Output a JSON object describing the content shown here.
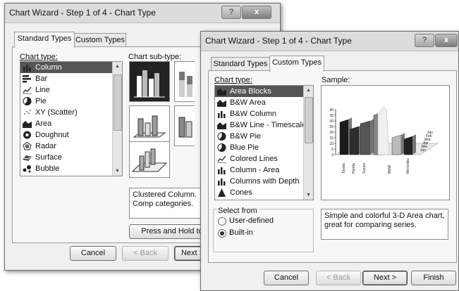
{
  "back_dialog": {
    "title": "Chart Wizard - Step 1 of 4 - Chart Type",
    "help_label": "?",
    "close_label": "x",
    "tabs": [
      {
        "label": "Standard Types",
        "active": true
      },
      {
        "label": "Custom Types",
        "active": false
      }
    ],
    "chart_type_label": "Chart type:",
    "subtype_label": "Chart sub-type:",
    "chart_types": [
      {
        "label": "Column",
        "icon": "column-chart-icon",
        "selected": true
      },
      {
        "label": "Bar",
        "icon": "bar-chart-icon"
      },
      {
        "label": "Line",
        "icon": "line-chart-icon"
      },
      {
        "label": "Pie",
        "icon": "pie-chart-icon"
      },
      {
        "label": "XY (Scatter)",
        "icon": "scatter-chart-icon"
      },
      {
        "label": "Area",
        "icon": "area-chart-icon"
      },
      {
        "label": "Doughnut",
        "icon": "doughnut-chart-icon"
      },
      {
        "label": "Radar",
        "icon": "radar-chart-icon"
      },
      {
        "label": "Surface",
        "icon": "surface-chart-icon"
      },
      {
        "label": "Bubble",
        "icon": "bubble-chart-icon"
      }
    ],
    "subtype_description": "Clustered Column. Comp categories.",
    "press_hold_label": "Press and Hold to",
    "buttons": {
      "cancel": "Cancel",
      "back": "< Back",
      "next": "Next >"
    }
  },
  "front_dialog": {
    "title": "Chart Wizard - Step 1 of 4 - Chart Type",
    "help_label": "?",
    "close_label": "x",
    "tabs": [
      {
        "label": "Standard Types",
        "active": false
      },
      {
        "label": "Custom Types",
        "active": true
      }
    ],
    "chart_type_label": "Chart type:",
    "sample_label": "Sample:",
    "chart_types": [
      {
        "label": "Area Blocks",
        "icon": "area-blocks-icon",
        "selected": true
      },
      {
        "label": "B&W Area",
        "icon": "area-chart-icon"
      },
      {
        "label": "B&W Column",
        "icon": "column-chart-icon"
      },
      {
        "label": "B&W Line - Timescale",
        "icon": "area-chart-icon"
      },
      {
        "label": "B&W Pie",
        "icon": "pie-chart-icon"
      },
      {
        "label": "Blue Pie",
        "icon": "pie-chart-icon"
      },
      {
        "label": "Colored Lines",
        "icon": "line-chart-icon"
      },
      {
        "label": "Column - Area",
        "icon": "column-chart-icon"
      },
      {
        "label": "Columns with Depth",
        "icon": "column-chart-icon"
      },
      {
        "label": "Cones",
        "icon": "cone-chart-icon"
      }
    ],
    "select_from_label": "Select from",
    "radio_user_defined": "User-defined",
    "radio_built_in": "Built-in",
    "selected_source": "Built-in",
    "description": "Simple and colorful 3-D Area chart, great for comparing series.",
    "buttons": {
      "cancel": "Cancel",
      "back": "< Back",
      "next": "Next >",
      "finish": "Finish"
    }
  },
  "sample_chart": {
    "y_ticks": [
      "0",
      "5",
      "10",
      "15",
      "20",
      "25",
      "30",
      "35",
      "40"
    ],
    "x_categories": [
      "Toyota",
      "Honda",
      "Suzuki",
      "BMW",
      "Mercedez"
    ],
    "depth_categories": [
      "Jan",
      "Feb",
      "Mar",
      "Apr",
      "Mei",
      "Jun"
    ]
  }
}
